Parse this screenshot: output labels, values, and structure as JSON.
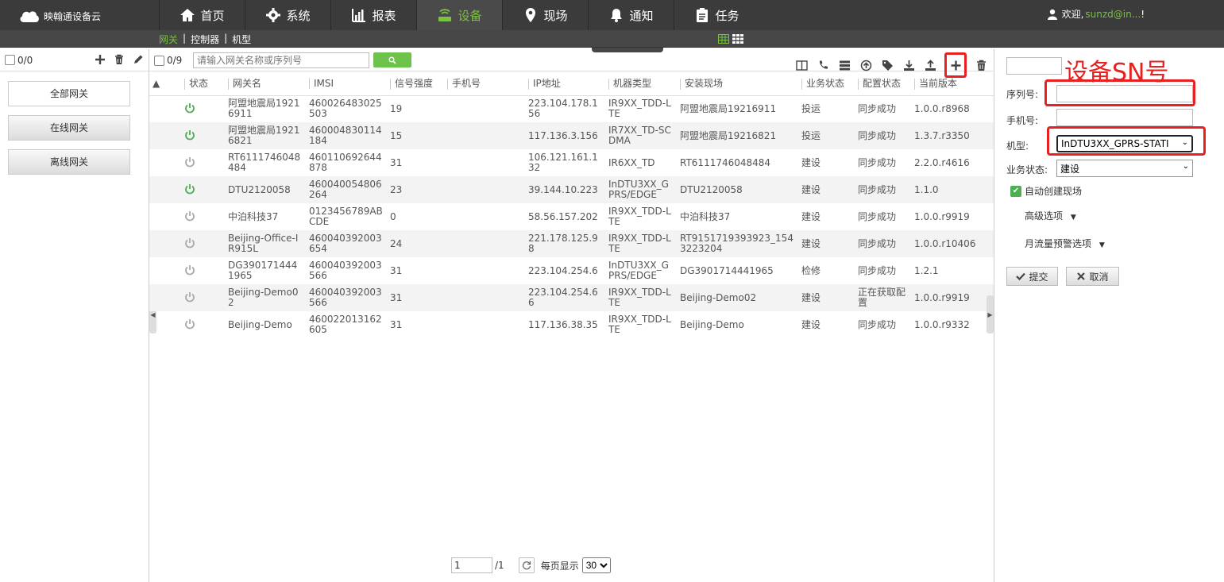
{
  "app": {
    "title": "映翰通设备云"
  },
  "nav": [
    {
      "label": "首页",
      "icon": "home-icon"
    },
    {
      "label": "系统",
      "icon": "gear-icon"
    },
    {
      "label": "报表",
      "icon": "chart-icon"
    },
    {
      "label": "设备",
      "icon": "router-icon",
      "active": true
    },
    {
      "label": "现场",
      "icon": "map-pin-icon"
    },
    {
      "label": "通知",
      "icon": "bell-icon"
    },
    {
      "label": "任务",
      "icon": "clipboard-icon"
    }
  ],
  "user": {
    "greeting": "欢迎,",
    "name": "sunzd@in...",
    "suffix": "!"
  },
  "subnav": {
    "items": [
      "网关",
      "控制器",
      "机型"
    ],
    "sep": "|"
  },
  "left": {
    "count": "0/0",
    "buttons": [
      "全部网关",
      "在线网关",
      "离线网关"
    ]
  },
  "toolbar": {
    "count": "0/9",
    "search_placeholder": "请输入网关名称或序列号"
  },
  "table": {
    "sort_arrow": "▲",
    "columns": [
      "状态",
      "网关名",
      "IMSI",
      "信号强度",
      "手机号",
      "IP地址",
      "机器类型",
      "安装现场",
      "业务状态",
      "配置状态",
      "当前版本"
    ],
    "rows": [
      {
        "online": true,
        "name": "阿盟地震局19216911",
        "imsi": "460026483025503",
        "signal": "19",
        "phone": "",
        "ip": "223.104.178.156",
        "model": "IR9XX_TDD-LTE",
        "site": "阿盟地震局19216911",
        "biz": "投运",
        "config": "同步成功",
        "version": "1.0.0.r8968"
      },
      {
        "online": true,
        "name": "阿盟地震局19216821",
        "imsi": "460004830114184",
        "signal": "15",
        "phone": "",
        "ip": "117.136.3.156",
        "model": "IR7XX_TD-SCDMA",
        "site": "阿盟地震局19216821",
        "biz": "投运",
        "config": "同步成功",
        "version": "1.3.7.r3350"
      },
      {
        "online": false,
        "name": "RT6111746048484",
        "imsi": "460110692644878",
        "signal": "31",
        "phone": "",
        "ip": "106.121.161.132",
        "model": "IR6XX_TD",
        "site": "RT6111746048484",
        "biz": "建设",
        "config": "同步成功",
        "version": "2.2.0.r4616"
      },
      {
        "online": true,
        "name": "DTU2120058",
        "imsi": "460040054806264",
        "signal": "23",
        "phone": "",
        "ip": "39.144.10.223",
        "model": "InDTU3XX_GPRS/EDGE",
        "site": "DTU2120058",
        "biz": "建设",
        "config": "同步成功",
        "version": "1.1.0"
      },
      {
        "online": false,
        "name": "中泊科技37",
        "imsi": "0123456789ABCDE",
        "signal": "0",
        "phone": "",
        "ip": "58.56.157.202",
        "model": "IR9XX_TDD-LTE",
        "site": "中泊科技37",
        "biz": "建设",
        "config": "同步成功",
        "version": "1.0.0.r9919"
      },
      {
        "online": false,
        "name": "Beijing-Office-IR915L",
        "imsi": "460040392003654",
        "signal": "24",
        "phone": "",
        "ip": "221.178.125.98",
        "model": "IR9XX_TDD-LTE",
        "site": "RT9151719393923_1543223204",
        "biz": "建设",
        "config": "同步成功",
        "version": "1.0.0.r10406"
      },
      {
        "online": false,
        "name": "DG3901714441965",
        "imsi": "460040392003566",
        "signal": "31",
        "phone": "",
        "ip": "223.104.254.6",
        "model": "InDTU3XX_GPRS/EDGE",
        "site": "DG3901714441965",
        "biz": "检修",
        "config": "同步成功",
        "version": "1.2.1"
      },
      {
        "online": false,
        "name": "Beijing-Demo02",
        "imsi": "460040392003566",
        "signal": "31",
        "phone": "",
        "ip": "223.104.254.66",
        "model": "IR9XX_TDD-LTE",
        "site": "Beijing-Demo02",
        "biz": "建设",
        "config": "正在获取配置",
        "version": "1.0.0.r9919"
      },
      {
        "online": false,
        "name": "Beijing-Demo",
        "imsi": "460022013162605",
        "signal": "31",
        "phone": "",
        "ip": "117.136.38.35",
        "model": "IR9XX_TDD-LTE",
        "site": "Beijing-Demo",
        "biz": "建设",
        "config": "同步成功",
        "version": "1.0.0.r9332"
      }
    ]
  },
  "pager": {
    "page": "1",
    "total": "/1",
    "per_page_label": "每页显示",
    "per_page": "30"
  },
  "form": {
    "annotation": "设备SN号",
    "serial_label": "序列号:",
    "serial_value": "",
    "phone_label": "手机号:",
    "phone_value": "",
    "model_label": "机型:",
    "model_value": "InDTU3XX_GPRS-STATI",
    "biz_label": "业务状态:",
    "biz_value": "建设",
    "auto_create": "自动创建现场",
    "advanced": "高级选项",
    "traffic_alert": "月流量预警选项",
    "submit": "提交",
    "cancel": "取消"
  },
  "colors": {
    "accent": "#7bc143",
    "highlight": "#e82020",
    "topbar": "#3b3b3b"
  }
}
